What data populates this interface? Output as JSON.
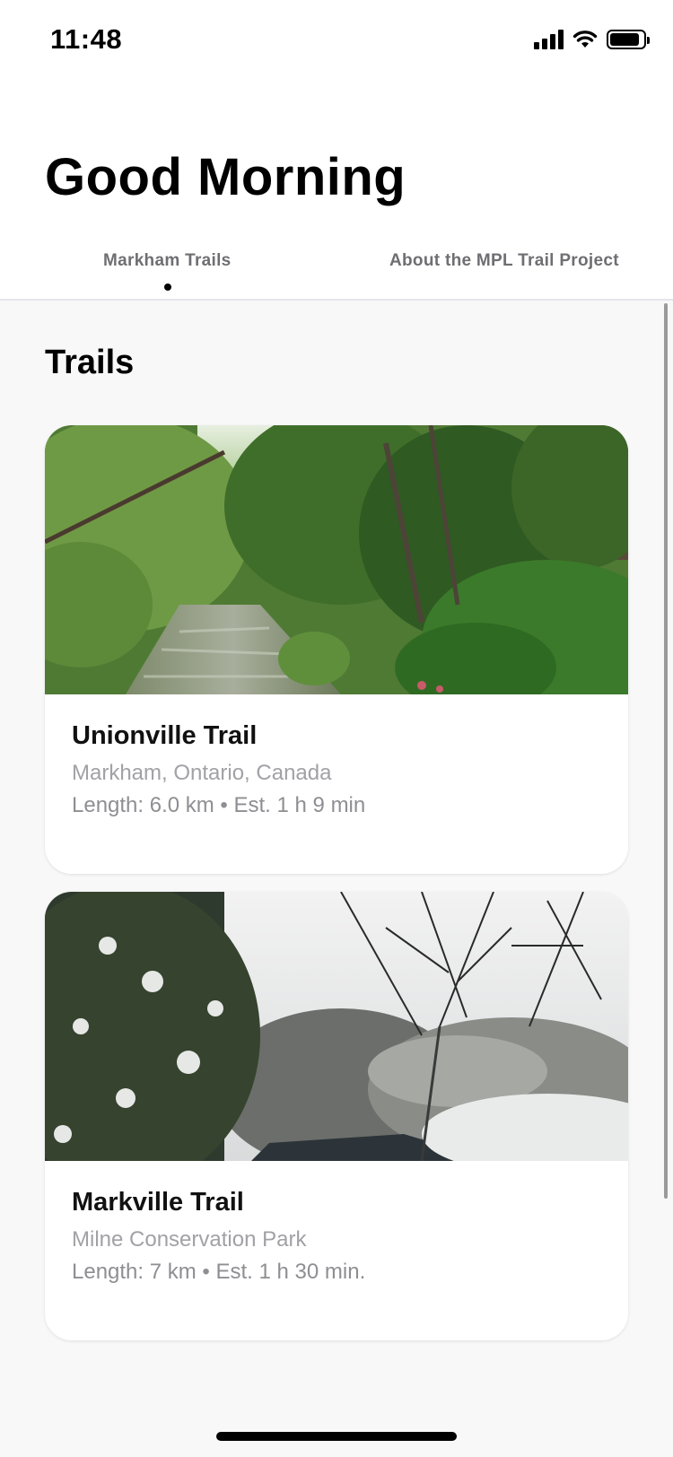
{
  "status_bar": {
    "time": "11:48",
    "battery_level": 0.9
  },
  "header": {
    "greeting": "Good Morning"
  },
  "tabs": [
    {
      "label": "Markham Trails",
      "active": true
    },
    {
      "label": "About the MPL Trail Project",
      "active": false
    }
  ],
  "section": {
    "title": "Trails"
  },
  "trails": [
    {
      "name": "Unionville Trail",
      "location": "Markham, Ontario, Canada",
      "meta": "Length: 6.0 km • Est. 1 h 9 min",
      "image": "summer-creek-forest-photo"
    },
    {
      "name": "Markville Trail",
      "location": "Milne Conservation Park",
      "meta": "Length: 7 km • Est. 1 h 30 min.",
      "image": "snowy-creek-forest-photo"
    }
  ],
  "colors": {
    "accent": "#000000",
    "secondary_text": "#8e8e93",
    "content_background": "#f8f8f8"
  }
}
